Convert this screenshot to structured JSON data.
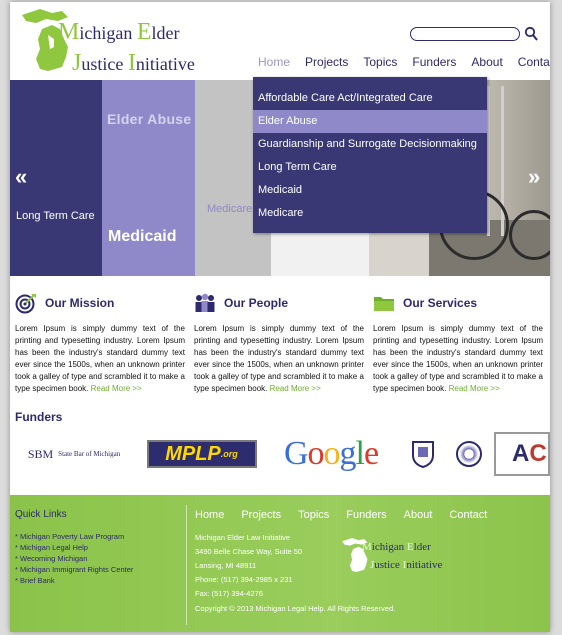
{
  "header": {
    "logo": {
      "line1_lead": "M",
      "line1_word1": "ichigan ",
      "line1_cap2": "E",
      "line1_word2": "lder",
      "line2_cap1": "J",
      "line2_word1": "ustice ",
      "line2_cap2": "I",
      "line2_word2": "nitiative"
    },
    "search": {
      "placeholder": "",
      "value": ""
    },
    "nav": [
      "Home",
      "Projects",
      "Topics",
      "Funders",
      "About",
      "Contact"
    ]
  },
  "slider": {
    "labels": [
      "Long Term Care",
      "Elder Abuse",
      "Medicaid",
      "Medicare"
    ],
    "arrow_left": "«",
    "arrow_right": "»"
  },
  "dropdown": {
    "items": [
      "Affordable Care Act/Integrated Care",
      "Elder Abuse",
      "Guardianship and Surrogate Decisionmaking",
      "Long Term Care",
      "Medicaid",
      "Medicare"
    ],
    "selected_index": 1
  },
  "columns": [
    {
      "icon": "target-icon",
      "title": "Our Mission",
      "text": "Lorem Ipsum is simply dummy text of the printing and typesetting industry. Lorem Ipsum has been the industry's standard dummy text ever since the 1500s, when an unknown printer took a galley of type and scrambled it to make a type specimen book.",
      "more": "Read More >>"
    },
    {
      "icon": "people-icon",
      "title": "Our People",
      "text": "Lorem Ipsum is simply dummy text of the printing and typesetting industry. Lorem Ipsum has been the industry's standard dummy text ever since the 1500s, when an unknown printer took a galley of type and scrambled it to make a type specimen book.",
      "more": "Read More >>"
    },
    {
      "icon": "folder-icon",
      "title": "Our Services",
      "text": "Lorem Ipsum is simply dummy text of the printing and typesetting industry. Lorem Ipsum has been the industry's standard dummy text ever since the 1500s, when an unknown printer took a galley of type and scrambled it to make a type specimen book.",
      "more": "Read More >>"
    }
  ],
  "funders": {
    "title": "Funders",
    "sbm_mark": "SBM",
    "sbm_text": "State Bar of Michigan",
    "mplp": "MPLP",
    "mplp_suffix": ".org",
    "google": [
      "G",
      "o",
      "o",
      "g",
      "l",
      "e"
    ],
    "ac_a": "A",
    "ac_c": "C"
  },
  "footer": {
    "quick_links_title": "Quick Links",
    "quick_links": [
      "* Michigan Poverty Law Program",
      "* Michigan Legal Help",
      "* Wecoming Michigan",
      "* Michigan Immigrant Rights Center",
      "* Brief Bank"
    ],
    "nav": [
      "Home",
      "Projects",
      "Topics",
      "Funders",
      "About",
      "Contact"
    ],
    "address": [
      "Michigan Elder Law Initiative",
      "3490 Belle Chase Way, Suite 50",
      "Lansing, MI 48911",
      "Phone: (517) 394-2985 x 231",
      "Fax:   (517) 394-4276"
    ],
    "copyright": "Copyright © 2013 Michigan Legal Help. All Rights Reserved.",
    "logo": {
      "line1_lead": "M",
      "line1_word1": "ichigan ",
      "line1_cap2": "E",
      "line1_word2": "lder",
      "line2_cap1": "J",
      "line2_word1": "ustice ",
      "line2_cap2": "I",
      "line2_word2": "nitiative"
    }
  },
  "colors": {
    "brand_purple": "#2e2a6e",
    "lavender": "#8f89c9",
    "green": "#8bc34a",
    "link_green": "#6fae2c"
  }
}
